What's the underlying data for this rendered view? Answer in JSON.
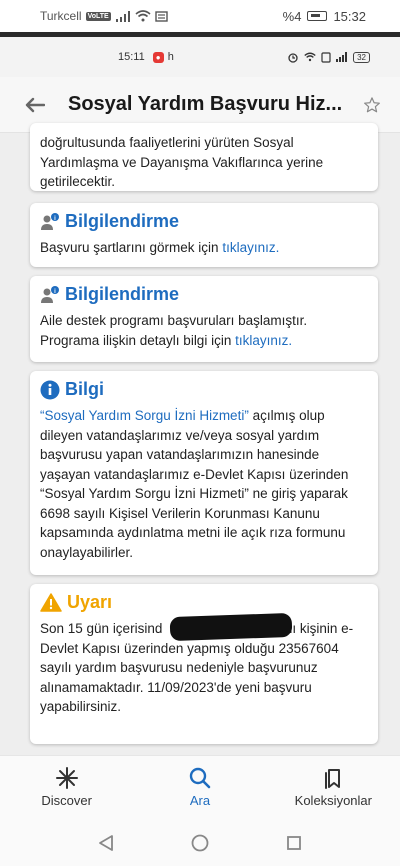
{
  "outer_status": {
    "carrier": "Turkcell",
    "volte": "VoLTE",
    "battery": "%4",
    "time": "15:32"
  },
  "inner_status": {
    "time": "15:11",
    "notif": "h",
    "battery": "32"
  },
  "app_bar": {
    "title": "Sosyal Yardım Başvuru Hiz..."
  },
  "intro_card": {
    "lines": [
      "doğrultusunda faaliyetlerini yürüten Sosyal",
      "Yardımlaşma ve Dayanışma Vakıflarınca yerine",
      "getirilecektir."
    ]
  },
  "info_card_1": {
    "title": "Bilgilendirme",
    "text": "Başvuru şartlarını görmek için ",
    "link": "tıklayınız."
  },
  "info_card_2": {
    "title": "Bilgilendirme",
    "line1": "Aile destek programı başvuruları başlamıştır.",
    "line2": "Programa ilişkin detaylı bilgi için ",
    "link": "tıklayınız."
  },
  "bilgi_card": {
    "title": "Bilgi",
    "link": "“Sosyal Yardım Sorgu İzni Hizmeti”",
    "first": " açılmış olup",
    "lines": [
      "dileyen vatandaşlarımız ve/veya sosyal yardım",
      "başvurusu yapan vatandaşlarımızın hanesinde",
      "yaşayan vatandaşlarımız e-Devlet Kapısı üzerinden",
      "“Sosyal Yardım Sorgu İzni Hizmeti” ne giriş yaparak",
      "6698 sayılı Kişisel Verilerin Korunması Kanunu",
      "kapsamında aydınlatma metni ile açık rıza formunu",
      "onaylayabilirler."
    ]
  },
  "warning_card": {
    "title": "Uyarı",
    "line1_start": "Son 15 gün içerisind",
    "line1_end": "adlı kişinin e-",
    "lines": [
      "Devlet Kapısı üzerinden yapmış olduğu 23567604",
      "sayılı yardım başvurusu nedeniyle başvurunuz",
      "alınamamaktadır. 11/09/2023'de yeni başvuru",
      "yapabilirsiniz."
    ]
  },
  "bottom_nav": {
    "discover": "Discover",
    "ara": "Ara",
    "koleksiyonlar": "Koleksiyonlar"
  },
  "colors": {
    "accent": "#1e6cbf",
    "warning": "#f0a400"
  }
}
